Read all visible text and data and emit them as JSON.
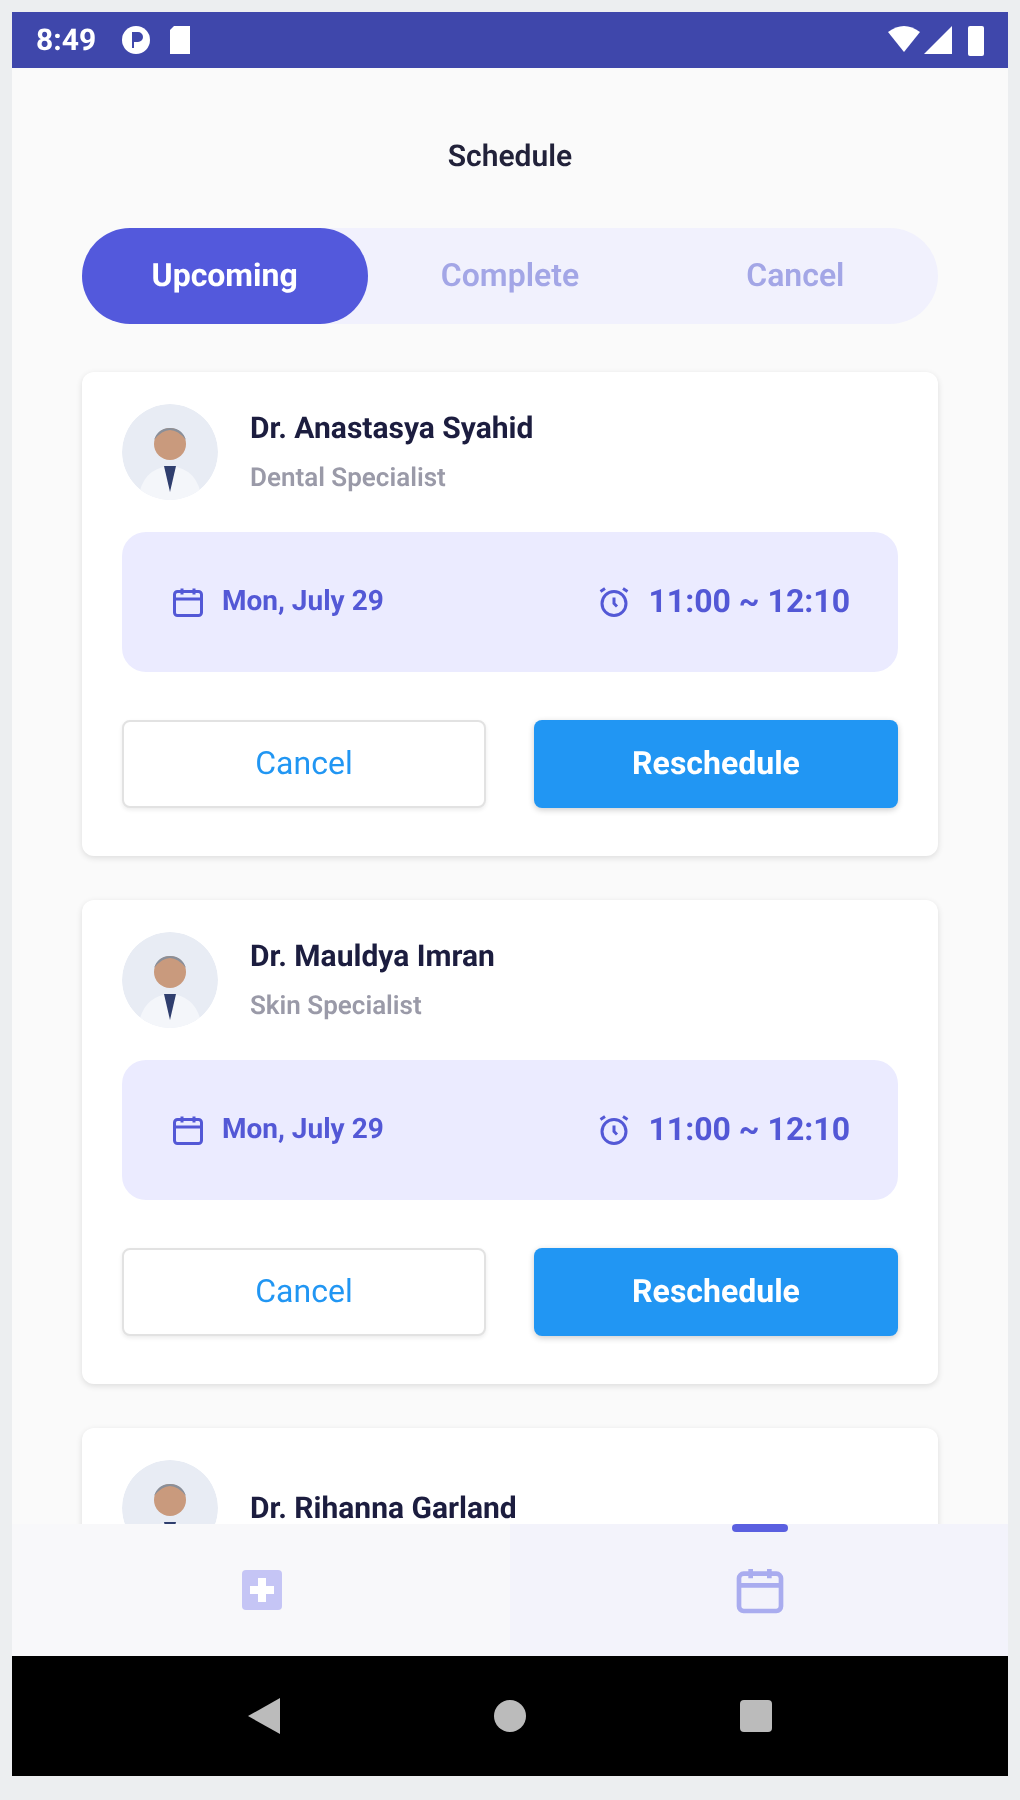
{
  "status_bar": {
    "time": "8:49"
  },
  "title": "Schedule",
  "tabs": [
    {
      "label": "Upcoming",
      "selected": true
    },
    {
      "label": "Complete",
      "selected": false
    },
    {
      "label": "Cancel",
      "selected": false
    }
  ],
  "appointments": [
    {
      "doctor": "Dr. Anastasya Syahid",
      "specialty": "Dental Specialist",
      "date": "Mon, July 29",
      "time": "11:00 ~ 12:10",
      "cancel_label": "Cancel",
      "reschedule_label": "Reschedule"
    },
    {
      "doctor": "Dr. Mauldya Imran",
      "specialty": "Skin Specialist",
      "date": "Mon, July 29",
      "time": "11:00 ~ 12:10",
      "cancel_label": "Cancel",
      "reschedule_label": "Reschedule"
    },
    {
      "doctor": "Dr. Rihanna Garland"
    }
  ],
  "bottom_nav": [
    {
      "kind": "clinic",
      "selected": false
    },
    {
      "kind": "calendar",
      "selected": true
    }
  ]
}
